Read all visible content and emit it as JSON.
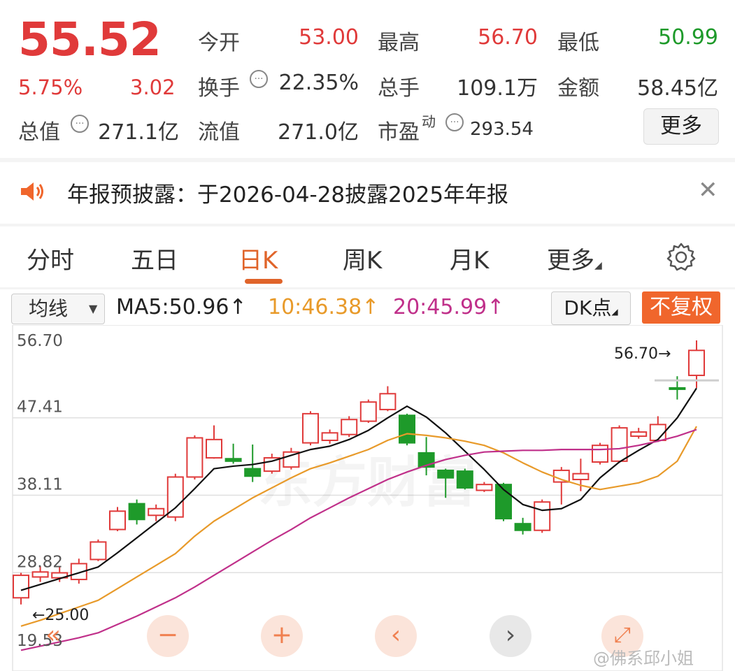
{
  "quote": {
    "price": "55.52",
    "change_pct": "5.75%",
    "change": "3.02",
    "stats": {
      "open_label": "今开",
      "open": "53.00",
      "high_label": "最高",
      "high": "56.70",
      "low_label": "最低",
      "low": "50.99",
      "turnover_label": "换手",
      "turnover": "22.35%",
      "volume_label": "总手",
      "volume": "109.1万",
      "amount_label": "金额",
      "amount": "58.45亿",
      "mcap_label": "总值",
      "mcap": "271.1亿",
      "float_label": "流值",
      "float_mcap": "271.0亿",
      "pe_label": "市盈",
      "pe_sup": "动",
      "pe": "293.54"
    },
    "more_label": "更多",
    "info_glyph": "…"
  },
  "notice": {
    "text": "年报预披露：于2026-04-28披露2025年年报",
    "close_glyph": "✕"
  },
  "tabs": {
    "items": [
      "分时",
      "五日",
      "日K",
      "周K",
      "月K",
      "更多"
    ],
    "active": "日K"
  },
  "indicators": {
    "select_label": "均线",
    "ma5": "MA5:50.96↑",
    "ma10": "10:46.38↑",
    "ma20": "20:45.99↑",
    "dk_label": "DK点",
    "adjust_label": "不复权"
  },
  "chart_data": {
    "type": "candlestick",
    "y_ticks": [
      "56.70",
      "47.41",
      "38.11",
      "28.82",
      "19.53"
    ],
    "ylim": [
      19.53,
      56.7
    ],
    "high_marker": "56.70→",
    "low_marker": "←25.00",
    "watermark": "东方财富",
    "candles": [
      {
        "o": 25.8,
        "c": 28.5,
        "h": 28.8,
        "l": 25.0
      },
      {
        "o": 28.3,
        "c": 28.9,
        "h": 29.6,
        "l": 27.7
      },
      {
        "o": 28.2,
        "c": 28.8,
        "h": 29.6,
        "l": 27.7
      },
      {
        "o": 28.0,
        "c": 29.9,
        "h": 30.5,
        "l": 27.5
      },
      {
        "o": 30.4,
        "c": 32.5,
        "h": 32.8,
        "l": 30.2
      },
      {
        "o": 34.0,
        "c": 36.2,
        "h": 36.7,
        "l": 33.8
      },
      {
        "o": 37.1,
        "c": 35.2,
        "h": 37.6,
        "l": 34.6
      },
      {
        "o": 35.7,
        "c": 36.5,
        "h": 37.0,
        "l": 35.0
      },
      {
        "o": 35.5,
        "c": 40.3,
        "h": 40.7,
        "l": 35.0
      },
      {
        "o": 40.3,
        "c": 45.0,
        "h": 45.3,
        "l": 40.0
      },
      {
        "o": 42.6,
        "c": 44.8,
        "h": 46.5,
        "l": 42.5
      },
      {
        "o": 42.5,
        "c": 42.2,
        "h": 44.3,
        "l": 41.9
      },
      {
        "o": 41.3,
        "c": 40.4,
        "h": 44.2,
        "l": 39.7
      },
      {
        "o": 41.0,
        "c": 42.6,
        "h": 43.1,
        "l": 40.7
      },
      {
        "o": 41.5,
        "c": 43.3,
        "h": 43.8,
        "l": 41.2
      },
      {
        "o": 44.4,
        "c": 47.9,
        "h": 48.2,
        "l": 44.1
      },
      {
        "o": 44.7,
        "c": 45.6,
        "h": 46.0,
        "l": 44.3
      },
      {
        "o": 45.4,
        "c": 47.2,
        "h": 47.6,
        "l": 45.1
      },
      {
        "o": 47.0,
        "c": 49.3,
        "h": 49.6,
        "l": 46.8
      },
      {
        "o": 48.4,
        "c": 50.3,
        "h": 51.2,
        "l": 48.2
      },
      {
        "o": 47.7,
        "c": 44.4,
        "h": 47.9,
        "l": 44.1
      },
      {
        "o": 43.2,
        "c": 41.5,
        "h": 45.1,
        "l": 40.5
      },
      {
        "o": 41.1,
        "c": 40.2,
        "h": 41.3,
        "l": 37.8
      },
      {
        "o": 41.0,
        "c": 39.0,
        "h": 41.3,
        "l": 38.8
      },
      {
        "o": 38.7,
        "c": 39.4,
        "h": 39.7,
        "l": 38.5
      },
      {
        "o": 39.4,
        "c": 35.3,
        "h": 39.6,
        "l": 35.0
      },
      {
        "o": 34.7,
        "c": 33.9,
        "h": 35.4,
        "l": 33.4
      },
      {
        "o": 33.9,
        "c": 37.3,
        "h": 37.6,
        "l": 33.6
      },
      {
        "o": 39.7,
        "c": 41.1,
        "h": 41.5,
        "l": 37.0
      },
      {
        "o": 40.0,
        "c": 40.7,
        "h": 42.5,
        "l": 38.6
      },
      {
        "o": 42.1,
        "c": 44.1,
        "h": 44.4,
        "l": 41.8
      },
      {
        "o": 42.2,
        "c": 46.2,
        "h": 46.5,
        "l": 42.0
      },
      {
        "o": 45.2,
        "c": 45.7,
        "h": 46.2,
        "l": 44.9
      },
      {
        "o": 44.7,
        "c": 46.6,
        "h": 47.6,
        "l": 44.5
      },
      {
        "o": 51.0,
        "c": 50.9,
        "h": 52.4,
        "l": 49.6
      },
      {
        "o": 52.5,
        "c": 55.5,
        "h": 56.7,
        "l": 50.99
      }
    ],
    "series": [
      {
        "name": "MA5",
        "color": "#111111",
        "values": [
          26.7,
          27.4,
          28.1,
          28.8,
          29.5,
          31.2,
          33.0,
          34.8,
          36.6,
          38.9,
          41.3,
          41.6,
          41.8,
          42.2,
          42.9,
          43.6,
          44.0,
          44.8,
          45.9,
          47.4,
          48.8,
          47.5,
          45.6,
          43.4,
          41.2,
          38.8,
          37.0,
          36.3,
          36.5,
          37.6,
          40.2,
          42.1,
          43.5,
          44.8,
          47.4,
          50.96
        ]
      },
      {
        "name": "10",
        "color": "#e89a2a",
        "values": [
          22.4,
          23.1,
          23.9,
          24.7,
          25.5,
          26.9,
          28.3,
          29.7,
          31.1,
          33.2,
          35.0,
          36.4,
          37.8,
          39.0,
          40.2,
          41.3,
          42.0,
          42.8,
          43.6,
          44.7,
          45.5,
          45.3,
          45.0,
          44.6,
          44.1,
          43.2,
          42.0,
          40.9,
          40.0,
          39.3,
          38.8,
          39.2,
          39.6,
          40.4,
          42.2,
          46.38
        ]
      },
      {
        "name": "20",
        "color": "#c0308a",
        "values": [
          19.5,
          20.0,
          20.5,
          21.0,
          21.6,
          22.6,
          23.6,
          24.7,
          25.8,
          27.1,
          28.5,
          29.9,
          31.3,
          32.7,
          34.0,
          35.4,
          36.6,
          37.8,
          38.9,
          40.0,
          40.9,
          41.7,
          42.4,
          42.9,
          43.3,
          43.4,
          43.5,
          43.5,
          43.6,
          43.6,
          43.6,
          43.7,
          44.1,
          44.6,
          45.2,
          45.99
        ]
      }
    ]
  },
  "controls": {
    "prev_fast_glyph": "«",
    "zoom_out_glyph": "−",
    "zoom_in_glyph": "+",
    "prev_glyph": "‹",
    "next_glyph": "›",
    "fullscreen_glyph": "⤢"
  },
  "watermark_weibo": "@佛系邱小姐"
}
